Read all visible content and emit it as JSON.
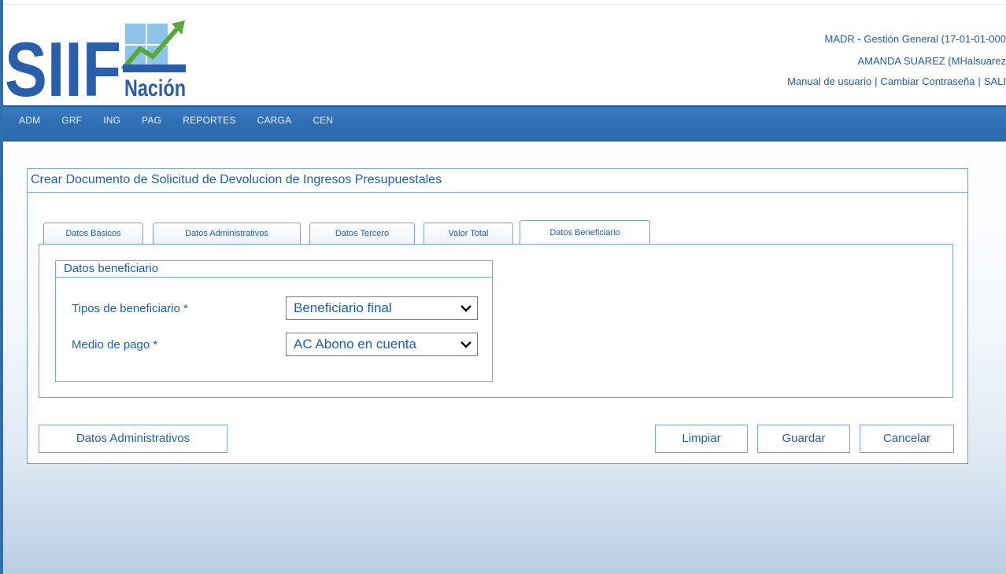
{
  "logo": {
    "text_main": "SIIF",
    "text_sub": "Nación"
  },
  "header": {
    "entity": "MADR - Gestión General (17-01-01-000",
    "user": "AMANDA SUAREZ (MHalsuarez",
    "links": {
      "manual": "Manual de usuario",
      "password": "Cambiar Contraseña",
      "exit": "SALI"
    },
    "separator": "|"
  },
  "menu": [
    {
      "label": "ADM"
    },
    {
      "label": "GRF"
    },
    {
      "label": "ING"
    },
    {
      "label": "PAG"
    },
    {
      "label": "REPORTES"
    },
    {
      "label": "CARGA"
    },
    {
      "label": "CEN"
    }
  ],
  "page": {
    "title": "Crear Documento de Solicitud de Devolucion de Ingresos Presupuestales"
  },
  "tabs": [
    {
      "label": "Datos Básicos",
      "active": false
    },
    {
      "label": "Datos Administrativos",
      "active": false
    },
    {
      "label": "Datos Tercero",
      "active": false
    },
    {
      "label": "Valor Total",
      "active": false
    },
    {
      "label": "Datos Beneficiario",
      "active": true
    }
  ],
  "beneficiary": {
    "legend": "Datos beneficiario",
    "type_label": "Tipos de beneficiario *",
    "type_value": "Beneficiario final",
    "payment_label": "Medio de pago *",
    "payment_value": "AC Abono en cuenta"
  },
  "buttons": {
    "back": "Datos Administrativos",
    "clear": "Limpiar",
    "save": "Guardar",
    "cancel": "Cancelar"
  },
  "colors": {
    "accent": "#1f5fa6",
    "menubar": "#2f6fb3",
    "border": "#7ba3cf"
  }
}
